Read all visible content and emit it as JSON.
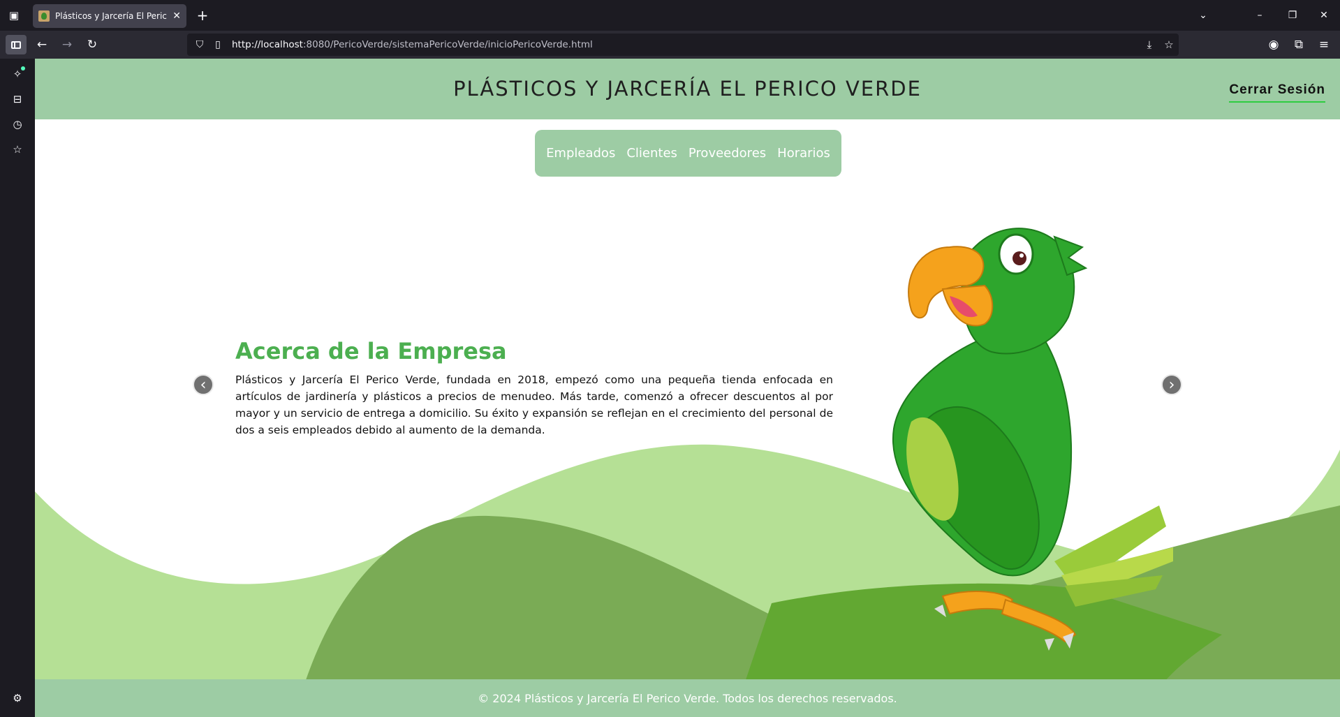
{
  "browser": {
    "tab_title": "Plásticos y Jarcería El Perico Verde",
    "url_host": "http://localhost",
    "url_rest": ":8080/PericoVerde/sistemaPericoVerde/inicioPericoVerde.html"
  },
  "site": {
    "title": "PLÁSTICOS Y JARCERÍA EL PERICO VERDE",
    "logout_label": "Cerrar Sesión",
    "menu": [
      {
        "label": "Empleados"
      },
      {
        "label": "Clientes"
      },
      {
        "label": "Proveedores"
      },
      {
        "label": "Horarios"
      }
    ],
    "about_title": "Acerca de la Empresa",
    "about_text": "Plásticos y Jarcería El Perico Verde, fundada en 2018, empezó como una pequeña tienda enfocada en artículos de jardinería y plásticos a precios de menudeo. Más tarde, comenzó a ofrecer descuentos al por mayor y un servicio de entrega a domicilio. Su éxito y expansión se reflejan en el crecimiento del personal de dos a seis empleados debido al aumento de la demanda.",
    "carousel_prev": "‹",
    "carousel_next": "›",
    "footer": "© 2024 Plásticos y Jarcería El Perico Verde. Todos los derechos reservados."
  },
  "colors": {
    "header_green": "#9dcca4",
    "title_green": "#4caf50",
    "wave_light": "#b5e095",
    "wave_mid": "#7aab55",
    "wave_dark": "#62a832"
  }
}
